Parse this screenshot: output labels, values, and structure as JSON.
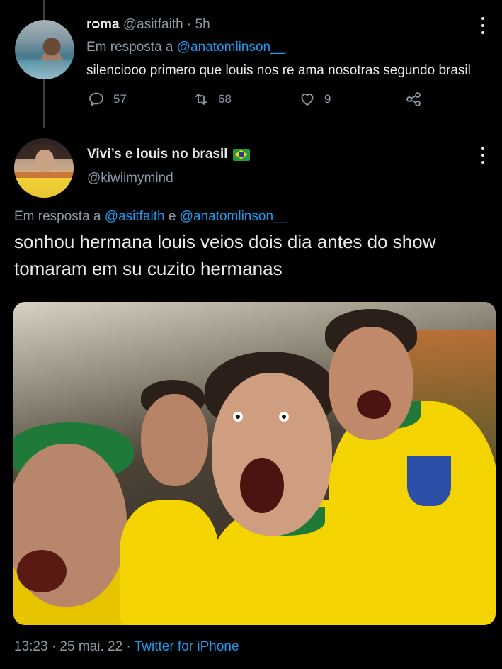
{
  "tweet1": {
    "display_name": "rᴑma",
    "handle": "@asitfaith",
    "separator": "·",
    "time": "5h",
    "reply_prefix": "Em resposta a",
    "reply_to": "@anatomlinson__",
    "text": "silenciooo primero que louis nos re ama nosotras segundo brasil",
    "replies": "57",
    "retweets": "68",
    "likes": "9"
  },
  "tweet2": {
    "display_name": "Vivi’s e louis no brasil",
    "handle": "@kiwiimymind",
    "reply_prefix": "Em resposta a",
    "reply_to_1": "@asitfaith",
    "reply_join": "e",
    "reply_to_2": "@anatomlinson__",
    "text_line1": "sonhou hermana louis veios dois dia antes do show",
    "text_line2": "tomaram em su cuzito hermanas",
    "timestamp": "13:23 · 25 mai. 22 ·",
    "source": "Twitter for iPhone"
  },
  "icons": {
    "reply": "reply-icon",
    "retweet": "retweet-icon",
    "like": "heart-icon",
    "share": "share-icon",
    "more": "more-options-icon",
    "flag": "brazil-flag-icon"
  },
  "colors": {
    "background": "#000000",
    "text": "#e7e9ea",
    "muted": "#8b98a5",
    "link": "#1d9bf0"
  }
}
